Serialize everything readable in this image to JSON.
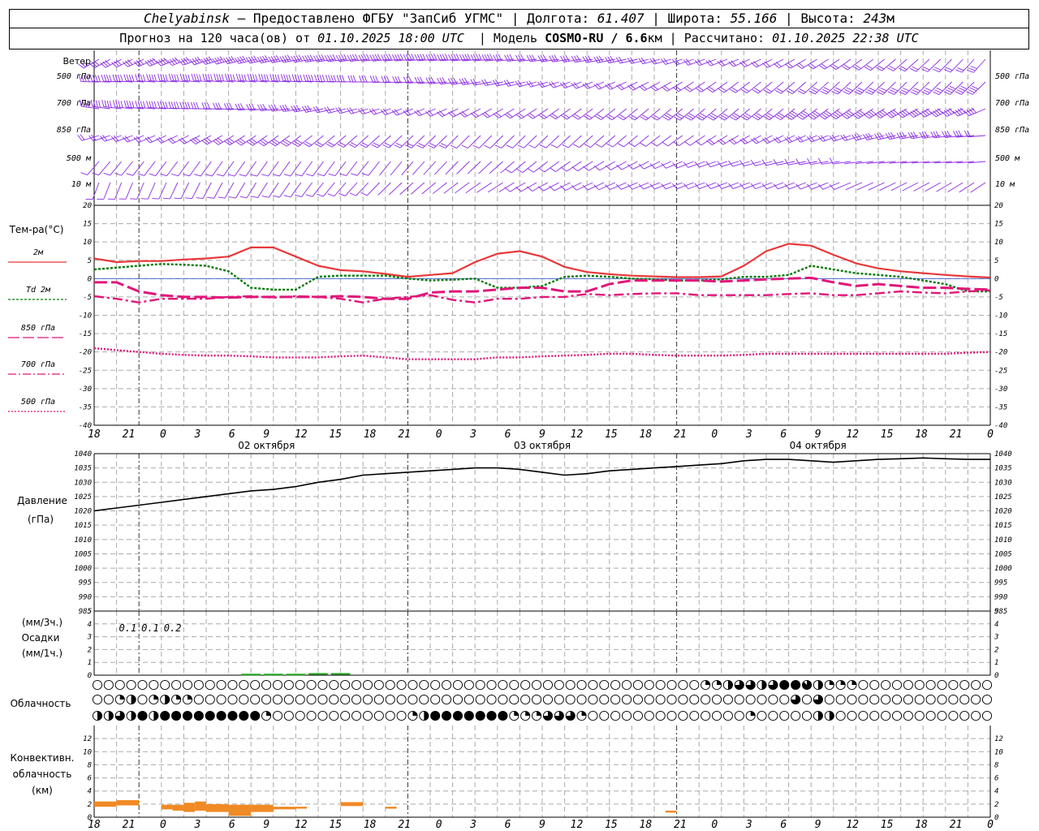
{
  "header": {
    "station": "Chelyabinsk",
    "provided_by": "— Предоставлено ФГБУ \"ЗапСиб УГМС\"",
    "lon_label": "Долгота:",
    "lon": "61.407",
    "lat_label": "Широта:",
    "lat": "55.166",
    "alt_label": "Высота:",
    "alt": "243",
    "alt_unit": "м"
  },
  "subheader": {
    "forecast_label": "Прогноз на 120 часа(ов) от",
    "forecast_time": "01.10.2025 18:00 UTC",
    "model_label": "Модель",
    "model": "COSMO-RU / 6.6",
    "model_unit": "км",
    "computed_label": "Рассчитано:",
    "computed_time": "01.10.2025 22:38 UTC"
  },
  "colors": {
    "wind": "#8a2be2",
    "t2m": "#e8383a",
    "td2m": "#0a7a0a",
    "t850": "#e0167a",
    "t700": "#e0167a",
    "t500": "#e0167a",
    "pressure": "#000000",
    "precip": "#22aa22",
    "convective": "#f08a24",
    "grid": "#aaaaaa"
  },
  "x_axis": {
    "hour_labels": [
      "18",
      "21",
      "0",
      "3",
      "6",
      "9",
      "12",
      "15",
      "18",
      "21",
      "0",
      "3",
      "6",
      "9",
      "12",
      "15",
      "18",
      "21",
      "0",
      "3",
      "6",
      "9",
      "12",
      "15",
      "18",
      "21",
      "0"
    ],
    "day_labels": [
      "02 октября",
      "03 октября",
      "04 октября"
    ]
  },
  "wind_panel": {
    "title": "Ветер",
    "levels": [
      "500 гПа",
      "700 гПа",
      "850 гПа",
      "500 м",
      "10  м"
    ]
  },
  "temp_panel": {
    "title": "Тем-ра(°С)",
    "legend": [
      {
        "label": "2м",
        "style": "solid",
        "color_key": "t2m"
      },
      {
        "label": "Td  2м",
        "style": "dotted-green",
        "color_key": "td2m"
      },
      {
        "label": "850 гПа",
        "style": "long-dash",
        "color_key": "t850"
      },
      {
        "label": "700 гПа",
        "style": "dash-dot",
        "color_key": "t700"
      },
      {
        "label": "500 гПа",
        "style": "dotted",
        "color_key": "t500"
      }
    ],
    "ylim": [
      -40,
      20
    ],
    "yticks": [
      20,
      15,
      10,
      5,
      0,
      -5,
      -10,
      -15,
      -20,
      -25,
      -30,
      -35,
      -40
    ]
  },
  "pressure_panel": {
    "title": "Давление",
    "unit": "(гПа)",
    "ylim": [
      985,
      1040
    ],
    "yticks": [
      1040,
      1035,
      1030,
      1025,
      1020,
      1015,
      1010,
      1005,
      1000,
      995,
      990,
      985
    ]
  },
  "precip_panel": {
    "unit_3h": "(мм/3ч.)",
    "title": "Осадки",
    "unit_1h": "(мм/1ч.)",
    "ylim": [
      0,
      5
    ],
    "yticks": [
      5,
      4,
      3,
      2,
      1,
      0
    ],
    "labels": [
      {
        "hour": 22.5,
        "text": "0.1"
      },
      {
        "hour": 25.5,
        "text": "0.1"
      },
      {
        "hour": 28.5,
        "text": "0.2"
      }
    ]
  },
  "cloud_panel": {
    "title": "Облачность"
  },
  "conv_panel": {
    "title_line1": "Конвективн.",
    "title_line2": "облачность",
    "unit": "(км)",
    "ylim": [
      0,
      14
    ],
    "yticks": [
      12,
      10,
      8,
      6,
      4,
      2,
      0
    ]
  },
  "chart_data": [
    {
      "type": "line",
      "title": "Тем-ра(°С)",
      "x_hours_from_start": [
        0,
        3,
        6,
        9,
        12,
        15,
        18,
        21,
        24,
        27,
        30,
        33,
        36,
        39,
        42,
        45,
        48,
        51,
        54,
        57,
        60,
        63,
        66,
        69,
        72,
        75,
        78,
        81,
        84,
        87,
        90,
        93,
        96,
        99,
        102,
        105,
        108,
        111,
        114,
        117,
        120
      ],
      "ylim": [
        -40,
        20
      ],
      "series": [
        {
          "name": "2м",
          "values": [
            5.5,
            4.5,
            4.8,
            4.8,
            5.2,
            5.5,
            6.0,
            8.5,
            8.5,
            6.0,
            3.5,
            2.3,
            2.0,
            1.3,
            0.5,
            1.0,
            1.5,
            4.5,
            6.8,
            7.5,
            6.0,
            3.2,
            1.8,
            1.2,
            0.8,
            0.6,
            0.4,
            0.4,
            0.6,
            3.5,
            7.5,
            9.5,
            9.0,
            6.5,
            4.2,
            2.8,
            2.0,
            1.5,
            1.0,
            0.6,
            0.3
          ]
        },
        {
          "name": "Td  2м",
          "values": [
            2.5,
            3.0,
            3.5,
            4.0,
            3.8,
            3.5,
            2.0,
            -2.5,
            -3.0,
            -3.0,
            0.5,
            0.8,
            0.8,
            0.8,
            0.0,
            -0.5,
            -0.3,
            0.0,
            -2.5,
            -2.5,
            -2.0,
            0.5,
            0.8,
            0.5,
            0.0,
            -0.2,
            -0.5,
            -0.5,
            -0.2,
            0.5,
            0.5,
            1.0,
            3.5,
            2.5,
            1.5,
            1.0,
            0.5,
            -0.5,
            -1.5,
            -3.5,
            -3.5
          ]
        },
        {
          "name": "850 гПа",
          "values": [
            -1.0,
            -1.0,
            -3.5,
            -4.5,
            -5.0,
            -5.0,
            -5.2,
            -5.0,
            -5.0,
            -5.0,
            -5.0,
            -4.8,
            -5.0,
            -5.5,
            -5.5,
            -3.8,
            -3.5,
            -3.5,
            -3.0,
            -2.5,
            -2.5,
            -3.5,
            -3.5,
            -1.5,
            -0.5,
            -0.5,
            -0.5,
            -0.5,
            -0.8,
            -0.5,
            -0.2,
            0.0,
            0.2,
            -1.0,
            -2.0,
            -1.5,
            -2.0,
            -2.5,
            -2.5,
            -2.8,
            -3.0
          ]
        },
        {
          "name": "700 гПа",
          "values": [
            -4.8,
            -5.5,
            -6.5,
            -5.5,
            -5.5,
            -5.5,
            -5.0,
            -4.8,
            -5.2,
            -4.8,
            -5.0,
            -5.5,
            -6.5,
            -5.5,
            -5.0,
            -4.5,
            -5.8,
            -6.5,
            -5.5,
            -5.5,
            -5.0,
            -5.0,
            -4.2,
            -4.5,
            -4.2,
            -4.0,
            -4.0,
            -4.5,
            -4.5,
            -4.5,
            -4.5,
            -4.2,
            -4.0,
            -4.5,
            -4.5,
            -4.0,
            -3.5,
            -3.8,
            -4.0,
            -3.5,
            -3.2
          ]
        },
        {
          "name": "500 гПа",
          "values": [
            -19,
            -19.5,
            -20,
            -20.5,
            -20.8,
            -21,
            -21,
            -21.2,
            -21.5,
            -21.5,
            -21.5,
            -21.2,
            -21,
            -21.5,
            -22,
            -22,
            -22,
            -22,
            -21.5,
            -21.5,
            -21.2,
            -21,
            -20.8,
            -20.5,
            -20.5,
            -20.8,
            -21,
            -21,
            -21,
            -20.8,
            -20.5,
            -20.5,
            -20.5,
            -20.5,
            -20.5,
            -20.5,
            -20.5,
            -20.5,
            -20.5,
            -20.2,
            -20
          ]
        }
      ]
    },
    {
      "type": "line",
      "title": "Давление",
      "x_hours_from_start": [
        0,
        3,
        6,
        9,
        12,
        15,
        18,
        21,
        24,
        27,
        30,
        33,
        36,
        39,
        42,
        45,
        48,
        51,
        54,
        57,
        60,
        63,
        66,
        69,
        72,
        75,
        78,
        81,
        84,
        87,
        90,
        93,
        96,
        99,
        102,
        105,
        108,
        111,
        114,
        117,
        120
      ],
      "ylim": [
        985,
        1040
      ],
      "series": [
        {
          "name": "",
          "values": [
            1020,
            1021,
            1022,
            1023,
            1024,
            1025,
            1026,
            1027,
            1027.5,
            1028.5,
            1030,
            1031,
            1032.5,
            1033,
            1033.5,
            1034,
            1034.5,
            1035,
            1035,
            1034.5,
            1033.5,
            1032.5,
            1033,
            1034,
            1034.5,
            1035,
            1035.5,
            1036,
            1036.5,
            1037.5,
            1038,
            1038,
            1037.5,
            1037,
            1037.5,
            1038,
            1038.2,
            1038.5,
            1038.2,
            1038,
            1038
          ]
        }
      ]
    },
    {
      "type": "bar",
      "title": "Осадки",
      "x_hours_from_start": [
        21,
        24,
        27,
        30,
        33
      ],
      "ylim": [
        0,
        5
      ],
      "series": [
        {
          "name": "(мм/1ч.)",
          "values": [
            0.05,
            0.05,
            0.05,
            0.1,
            0.1
          ]
        }
      ]
    },
    {
      "type": "bar",
      "title": "Конвективн. облачность",
      "segments_km": [
        {
          "start": 0,
          "end": 3,
          "bottom": 1.6,
          "top": 2.4
        },
        {
          "start": 3,
          "end": 6,
          "bottom": 1.8,
          "top": 2.6
        },
        {
          "start": 9,
          "end": 10.5,
          "bottom": 1.2,
          "top": 1.9
        },
        {
          "start": 10.5,
          "end": 12,
          "bottom": 1.0,
          "top": 1.9
        },
        {
          "start": 12,
          "end": 13.5,
          "bottom": 0.8,
          "top": 2.2
        },
        {
          "start": 13.5,
          "end": 15,
          "bottom": 1.0,
          "top": 2.4
        },
        {
          "start": 15,
          "end": 18,
          "bottom": 0.8,
          "top": 2.0
        },
        {
          "start": 18,
          "end": 21,
          "bottom": 0.2,
          "top": 1.9
        },
        {
          "start": 21,
          "end": 24,
          "bottom": 0.8,
          "top": 1.9
        },
        {
          "start": 24,
          "end": 27,
          "bottom": 1.2,
          "top": 1.6
        },
        {
          "start": 27,
          "end": 28.5,
          "bottom": 1.3,
          "top": 1.6
        },
        {
          "start": 33,
          "end": 36,
          "bottom": 1.7,
          "top": 2.3
        },
        {
          "start": 39,
          "end": 40.5,
          "bottom": 1.3,
          "top": 1.6
        },
        {
          "start": 76.5,
          "end": 78,
          "bottom": 0.7,
          "top": 1.0
        }
      ]
    },
    {
      "type": "table",
      "title": "Облачность",
      "x_hours_from_start_step": 1.5,
      "rows": [
        {
          "name": "row1",
          "cover": [
            0,
            0,
            0,
            0,
            0,
            0,
            0,
            0,
            0,
            0,
            0,
            0,
            0,
            0,
            0,
            0,
            0,
            0,
            0,
            0,
            0,
            0,
            0,
            0,
            0,
            0,
            0,
            0,
            0,
            0,
            0,
            0,
            0,
            0,
            0,
            0,
            0,
            0,
            0,
            0,
            0,
            0,
            0,
            0,
            0,
            0,
            0,
            0,
            0,
            0,
            0,
            0,
            0,
            0,
            2,
            2,
            4,
            6,
            6,
            4,
            6,
            8,
            8,
            7,
            4,
            2,
            2,
            2,
            0,
            0,
            0,
            0,
            0,
            0,
            0,
            0,
            0,
            0,
            0,
            0,
            0,
            0,
            0,
            0,
            0,
            0,
            0,
            0,
            0,
            0,
            0,
            0,
            0,
            0,
            0,
            0,
            0,
            0,
            0,
            0,
            4,
            0,
            0,
            0,
            0,
            0,
            0,
            0,
            0,
            0,
            4,
            2,
            4,
            2,
            4,
            0,
            0,
            0,
            0,
            0,
            0,
            0,
            4,
            0,
            0
          ]
        },
        {
          "name": "row2",
          "cover": [
            0,
            0,
            2,
            4,
            0,
            2,
            4,
            2,
            2,
            0,
            0,
            0,
            0,
            0,
            0,
            0,
            0,
            0,
            0,
            0,
            0,
            0,
            0,
            0,
            0,
            0,
            0,
            0,
            0,
            0,
            0,
            0,
            0,
            0,
            0,
            0,
            0,
            0,
            0,
            0,
            0,
            0,
            0,
            0,
            0,
            0,
            0,
            0,
            0,
            0,
            0,
            0,
            0,
            0,
            0,
            0,
            0,
            0,
            0,
            0,
            0,
            0,
            6,
            0,
            6,
            0,
            0,
            0,
            0,
            0,
            0,
            0,
            0,
            0,
            0,
            0,
            0,
            0,
            0,
            0,
            0,
            0,
            0,
            0,
            0,
            0,
            0,
            0,
            0,
            0,
            0,
            0,
            0,
            0,
            0,
            0,
            0,
            0,
            0,
            0,
            0,
            0,
            0,
            0,
            0,
            0,
            0,
            0,
            0,
            0,
            0,
            0,
            0,
            0,
            0,
            0,
            0,
            0,
            0,
            0,
            0
          ]
        },
        {
          "name": "row3",
          "cover": [
            4,
            4,
            6,
            4,
            8,
            4,
            8,
            8,
            8,
            8,
            8,
            8,
            8,
            8,
            8,
            2,
            0,
            0,
            0,
            0,
            0,
            0,
            0,
            0,
            0,
            0,
            0,
            0,
            2,
            4,
            8,
            8,
            8,
            8,
            8,
            8,
            8,
            2,
            2,
            2,
            6,
            6,
            6,
            2,
            0,
            0,
            0,
            0,
            0,
            0,
            0,
            0,
            0,
            0,
            0,
            0,
            0,
            0,
            2,
            0,
            0,
            0,
            0,
            0,
            4,
            4,
            0,
            0,
            0,
            0,
            0,
            0,
            0,
            0,
            0,
            0,
            0,
            0,
            0,
            0,
            0,
            0,
            0,
            0,
            0,
            0,
            0,
            0,
            0,
            0,
            0,
            0,
            0,
            0,
            0,
            0,
            0,
            0,
            0,
            0,
            0,
            0,
            0,
            0,
            0,
            0,
            0,
            0,
            0,
            0,
            0,
            0,
            0,
            0,
            0,
            0,
            6,
            2,
            0,
            0,
            0,
            0,
            0
          ]
        }
      ]
    }
  ]
}
